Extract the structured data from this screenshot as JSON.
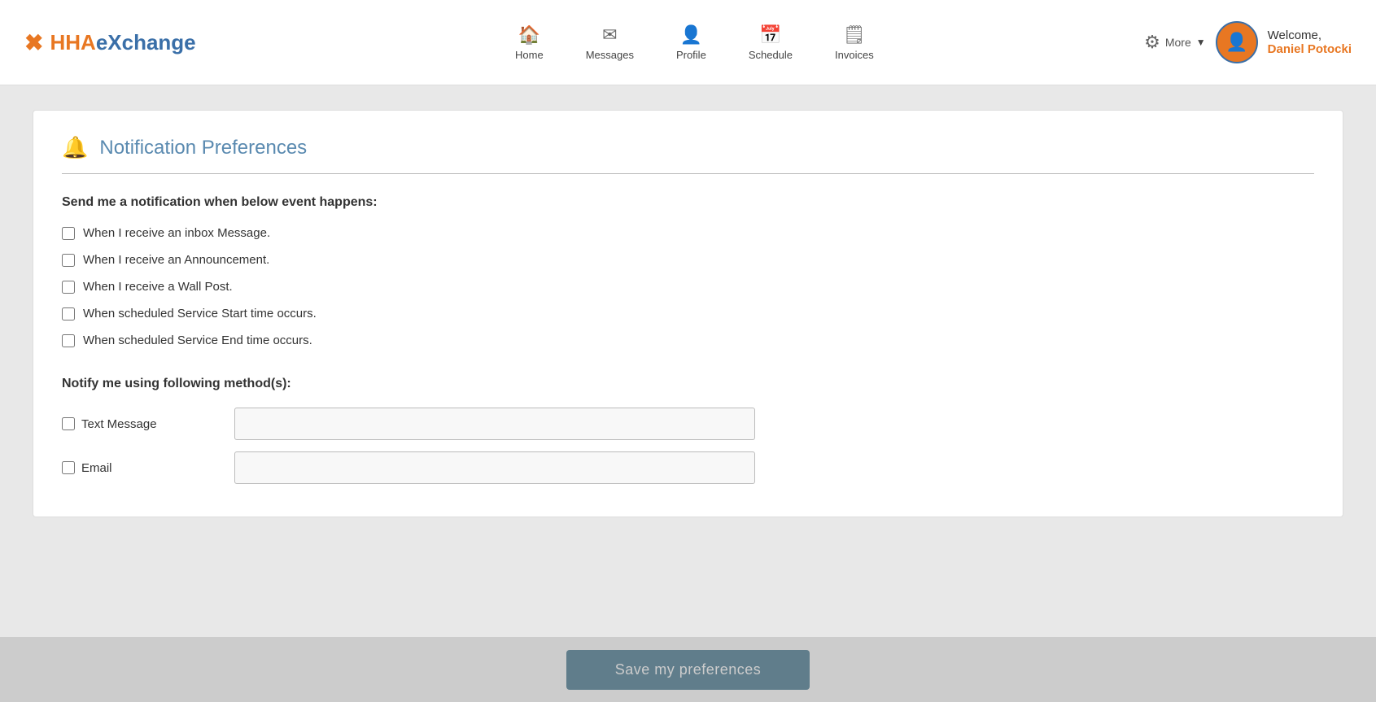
{
  "header": {
    "logo": {
      "hha": "HHA",
      "exchange": "eXchange"
    },
    "nav": [
      {
        "id": "home",
        "label": "Home",
        "icon": "🏠"
      },
      {
        "id": "messages",
        "label": "Messages",
        "icon": "✉"
      },
      {
        "id": "profile",
        "label": "Profile",
        "icon": "👤"
      },
      {
        "id": "schedule",
        "label": "Schedule",
        "icon": "📅"
      },
      {
        "id": "invoices",
        "label": "Invoices",
        "icon": "🗒"
      }
    ],
    "more_label": "More",
    "welcome_label": "Welcome,",
    "user_name": "Daniel Potocki"
  },
  "page": {
    "title": "Notification Preferences",
    "notification_section_label": "Send me a notification when below event happens:",
    "checkboxes": [
      {
        "id": "inbox_message",
        "label": "When I receive an inbox Message.",
        "checked": false
      },
      {
        "id": "announcement",
        "label": "When I receive an Announcement.",
        "checked": false
      },
      {
        "id": "wall_post",
        "label": "When I receive a Wall Post.",
        "checked": false
      },
      {
        "id": "service_start",
        "label": "When scheduled Service Start time occurs.",
        "checked": false
      },
      {
        "id": "service_end",
        "label": "When scheduled Service End time occurs.",
        "checked": false
      }
    ],
    "method_section_label": "Notify me using following method(s):",
    "methods": [
      {
        "id": "text_message",
        "label": "Text Message",
        "checked": false,
        "value": "",
        "placeholder": ""
      },
      {
        "id": "email",
        "label": "Email",
        "checked": false,
        "value": "",
        "placeholder": ""
      }
    ],
    "save_button_label": "Save my preferences"
  }
}
